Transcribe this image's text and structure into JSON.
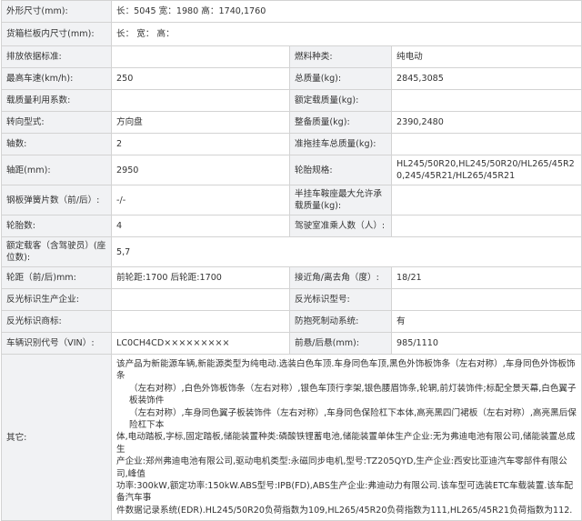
{
  "rows": [
    {
      "l1": "外形尺寸(mm):",
      "v1": "长：5045 宽：1980 高：1740,1760"
    },
    {
      "l1": "货箱栏板内尺寸(mm):",
      "v1": "长：  宽：  高："
    },
    {
      "l1": "排放依据标准:",
      "v1": "",
      "l2": "燃料种类:",
      "v2": "纯电动"
    },
    {
      "l1": "最高车速(km/h):",
      "v1": "250",
      "l2": "总质量(kg):",
      "v2": "2845,3085"
    },
    {
      "l1": "载质量利用系数:",
      "v1": "",
      "l2": "额定载质量(kg):",
      "v2": ""
    },
    {
      "l1": "转向型式:",
      "v1": "方向盘",
      "l2": "整备质量(kg):",
      "v2": "2390,2480"
    },
    {
      "l1": "轴数:",
      "v1": "2",
      "l2": "准拖挂车总质量(kg):",
      "v2": ""
    },
    {
      "l1": "轴距(mm):",
      "v1": "2950",
      "l2": "轮胎规格:",
      "v2": "HL245/50R20,HL245/50R20/HL265/45R20,245/45R21/HL265/45R21"
    },
    {
      "l1": "钢板弹簧片数（前/后）:",
      "v1": "-/-",
      "l2": "半挂车鞍座最大允许承载质量(kg):",
      "v2": ""
    },
    {
      "l1": "轮胎数:",
      "v1": "4",
      "l2": "驾驶室准乘人数（人）:",
      "v2": ""
    },
    {
      "l1": "额定载客（含驾驶员）(座位数):",
      "v1": "5,7"
    },
    {
      "l1": "轮距（前/后)mm:",
      "v1": "前轮距:1700 后轮距:1700",
      "l2": "接近角/离去角（度）:",
      "v2": "18/21"
    },
    {
      "l1": "反光标识生产企业:",
      "v1": "",
      "l2": "反光标识型号:",
      "v2": ""
    },
    {
      "l1": "反光标识商标:",
      "v1": "",
      "l2": "防抱死制动系统:",
      "v2": "有"
    },
    {
      "l1": "车辆识别代号（VIN）:",
      "v1": "LC0CH4CD×××××××××",
      "l2": "前悬/后悬(mm):",
      "v2": "985/1110"
    }
  ],
  "other": {
    "label": "其它:",
    "lines": [
      "该产品为新能源车辆,新能源类型为纯电动.选装白色车顶.车身同色车顶,黑色外饰板饰条（左右对称）,车身同色外饰板饰条",
      "（左右对称）,白色外饰板饰条（左右对称）,银色车顶行李架,银色腰眉饰条,轮辋,前灯装饰件;标配全景天幕,白色翼子板装饰件",
      "（左右对称）,车身同色翼子板装饰件（左右对称）,车身同色保险杠下本体,高亮黑四门裙板（左右对称）,高亮黑后保险杠下本",
      "体,电动踏板,字标,固定踏板,储能装置种类:磷酸铁锂蓄电池,储能装置单体生产企业:无为弗迪电池有限公司,储能装置总成生",
      "产企业:郑州弗迪电池有限公司,驱动电机类型:永磁同步电机,型号:TZ205QYD,生产企业:西安比亚迪汽车零部件有限公司,峰值",
      "功率:300kW,额定功率:150kW.ABS型号:IPB(FD),ABS生产企业:弗迪动力有限公司.该车型可选装ETC车载装置.该车配备汽车事",
      "件数据记录系统(EDR).HL245/50R20负荷指数为109,HL265/45R20负荷指数为111,HL265/45R21负荷指数为112."
    ]
  }
}
